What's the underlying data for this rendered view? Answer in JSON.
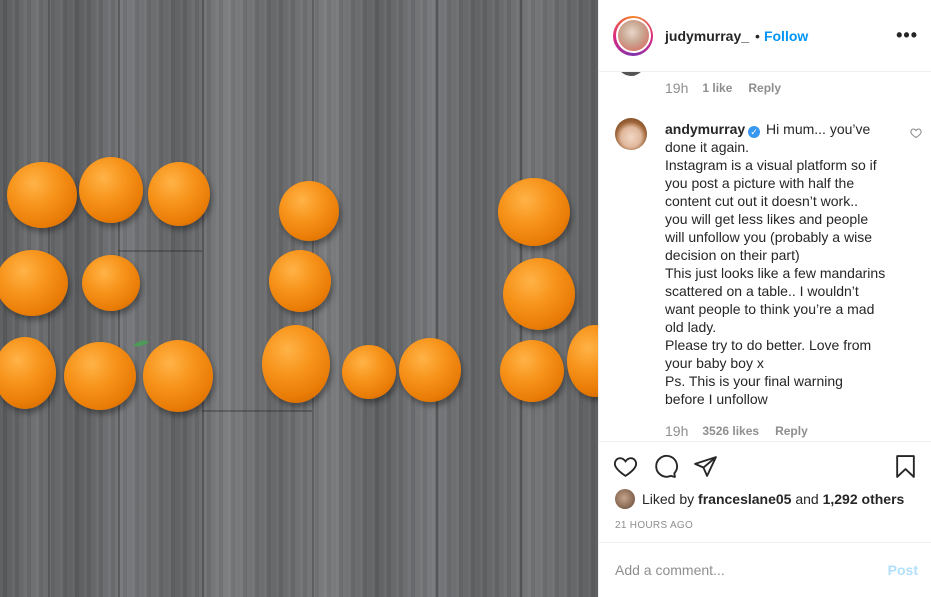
{
  "photo": {
    "alt_icon": "oranges-photo"
  },
  "header": {
    "username": "judymurray_",
    "separator": "•",
    "follow_label": "Follow",
    "more_icon": "more-horizontal-icon",
    "more_glyph": "•••"
  },
  "previous_comment": {
    "time": "19h",
    "likes": "1 like",
    "reply_label": "Reply"
  },
  "comment": {
    "username": "andymurray",
    "verified_glyph": "✓",
    "lines": [
      "Hi mum... you’ve",
      "done it again.",
      "Instagram is a visual platform so if",
      "you post a picture with half the",
      "content cut out it doesn’t work..",
      "you will get less likes and people",
      "will unfollow you (probably a wise",
      "decision on their part)",
      "This just looks like a few mandarins",
      "scattered on a table.. I wouldn’t",
      "want people to think you’re a mad",
      "old lady.",
      "Please try to do better. Love from",
      "your baby boy x",
      "Ps. This is your final warning",
      "before I unfollow"
    ],
    "time": "19h",
    "likes": "3526 likes",
    "reply_label": "Reply"
  },
  "actions": {
    "like_icon": "heart-icon",
    "comment_icon": "comment-icon",
    "share_icon": "share-icon",
    "save_icon": "bookmark-icon"
  },
  "likes": {
    "prefix": "Liked by",
    "user": "franceslane05",
    "middle": "and",
    "others": "1,292 others"
  },
  "timestamp": "21 hours ago",
  "add_comment": {
    "placeholder": "Add a comment...",
    "post_label": "Post",
    "post_color": "#b2dffc"
  },
  "colors": {
    "accent": "#0095f6",
    "verified": "#3897f0",
    "muted": "#8e8e8e"
  }
}
